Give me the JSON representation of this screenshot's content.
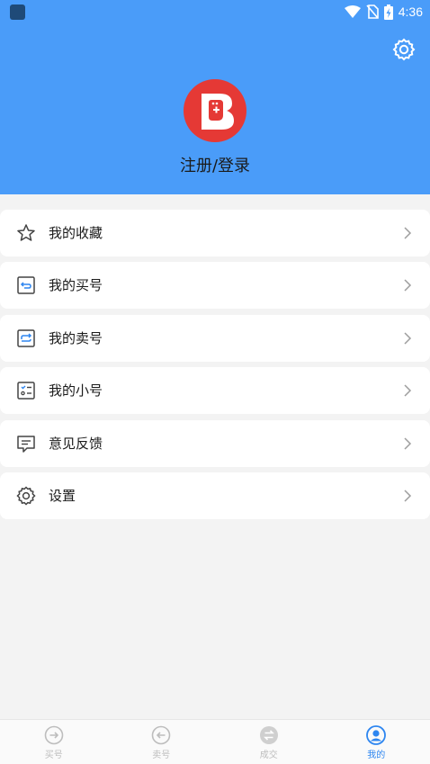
{
  "status_bar": {
    "time": "4:36"
  },
  "header": {
    "login_label": "注册/登录"
  },
  "menu": {
    "items": [
      {
        "label": "我的收藏",
        "icon": "star-icon"
      },
      {
        "label": "我的买号",
        "icon": "buy-account-icon"
      },
      {
        "label": "我的卖号",
        "icon": "sell-account-icon"
      },
      {
        "label": "我的小号",
        "icon": "sub-account-icon"
      },
      {
        "label": "意见反馈",
        "icon": "feedback-icon"
      },
      {
        "label": "设置",
        "icon": "gear-icon"
      }
    ]
  },
  "bottom_nav": {
    "tabs": [
      {
        "label": "买号",
        "icon": "buy-icon",
        "active": false
      },
      {
        "label": "卖号",
        "icon": "sell-icon",
        "active": false
      },
      {
        "label": "成交",
        "icon": "deal-icon",
        "active": false
      },
      {
        "label": "我的",
        "icon": "profile-icon",
        "active": true
      }
    ]
  },
  "colors": {
    "header_bg": "#4a9cf9",
    "accent": "#2e86f0",
    "logo_red": "#e53935",
    "inactive_nav": "#bdbdbd"
  }
}
